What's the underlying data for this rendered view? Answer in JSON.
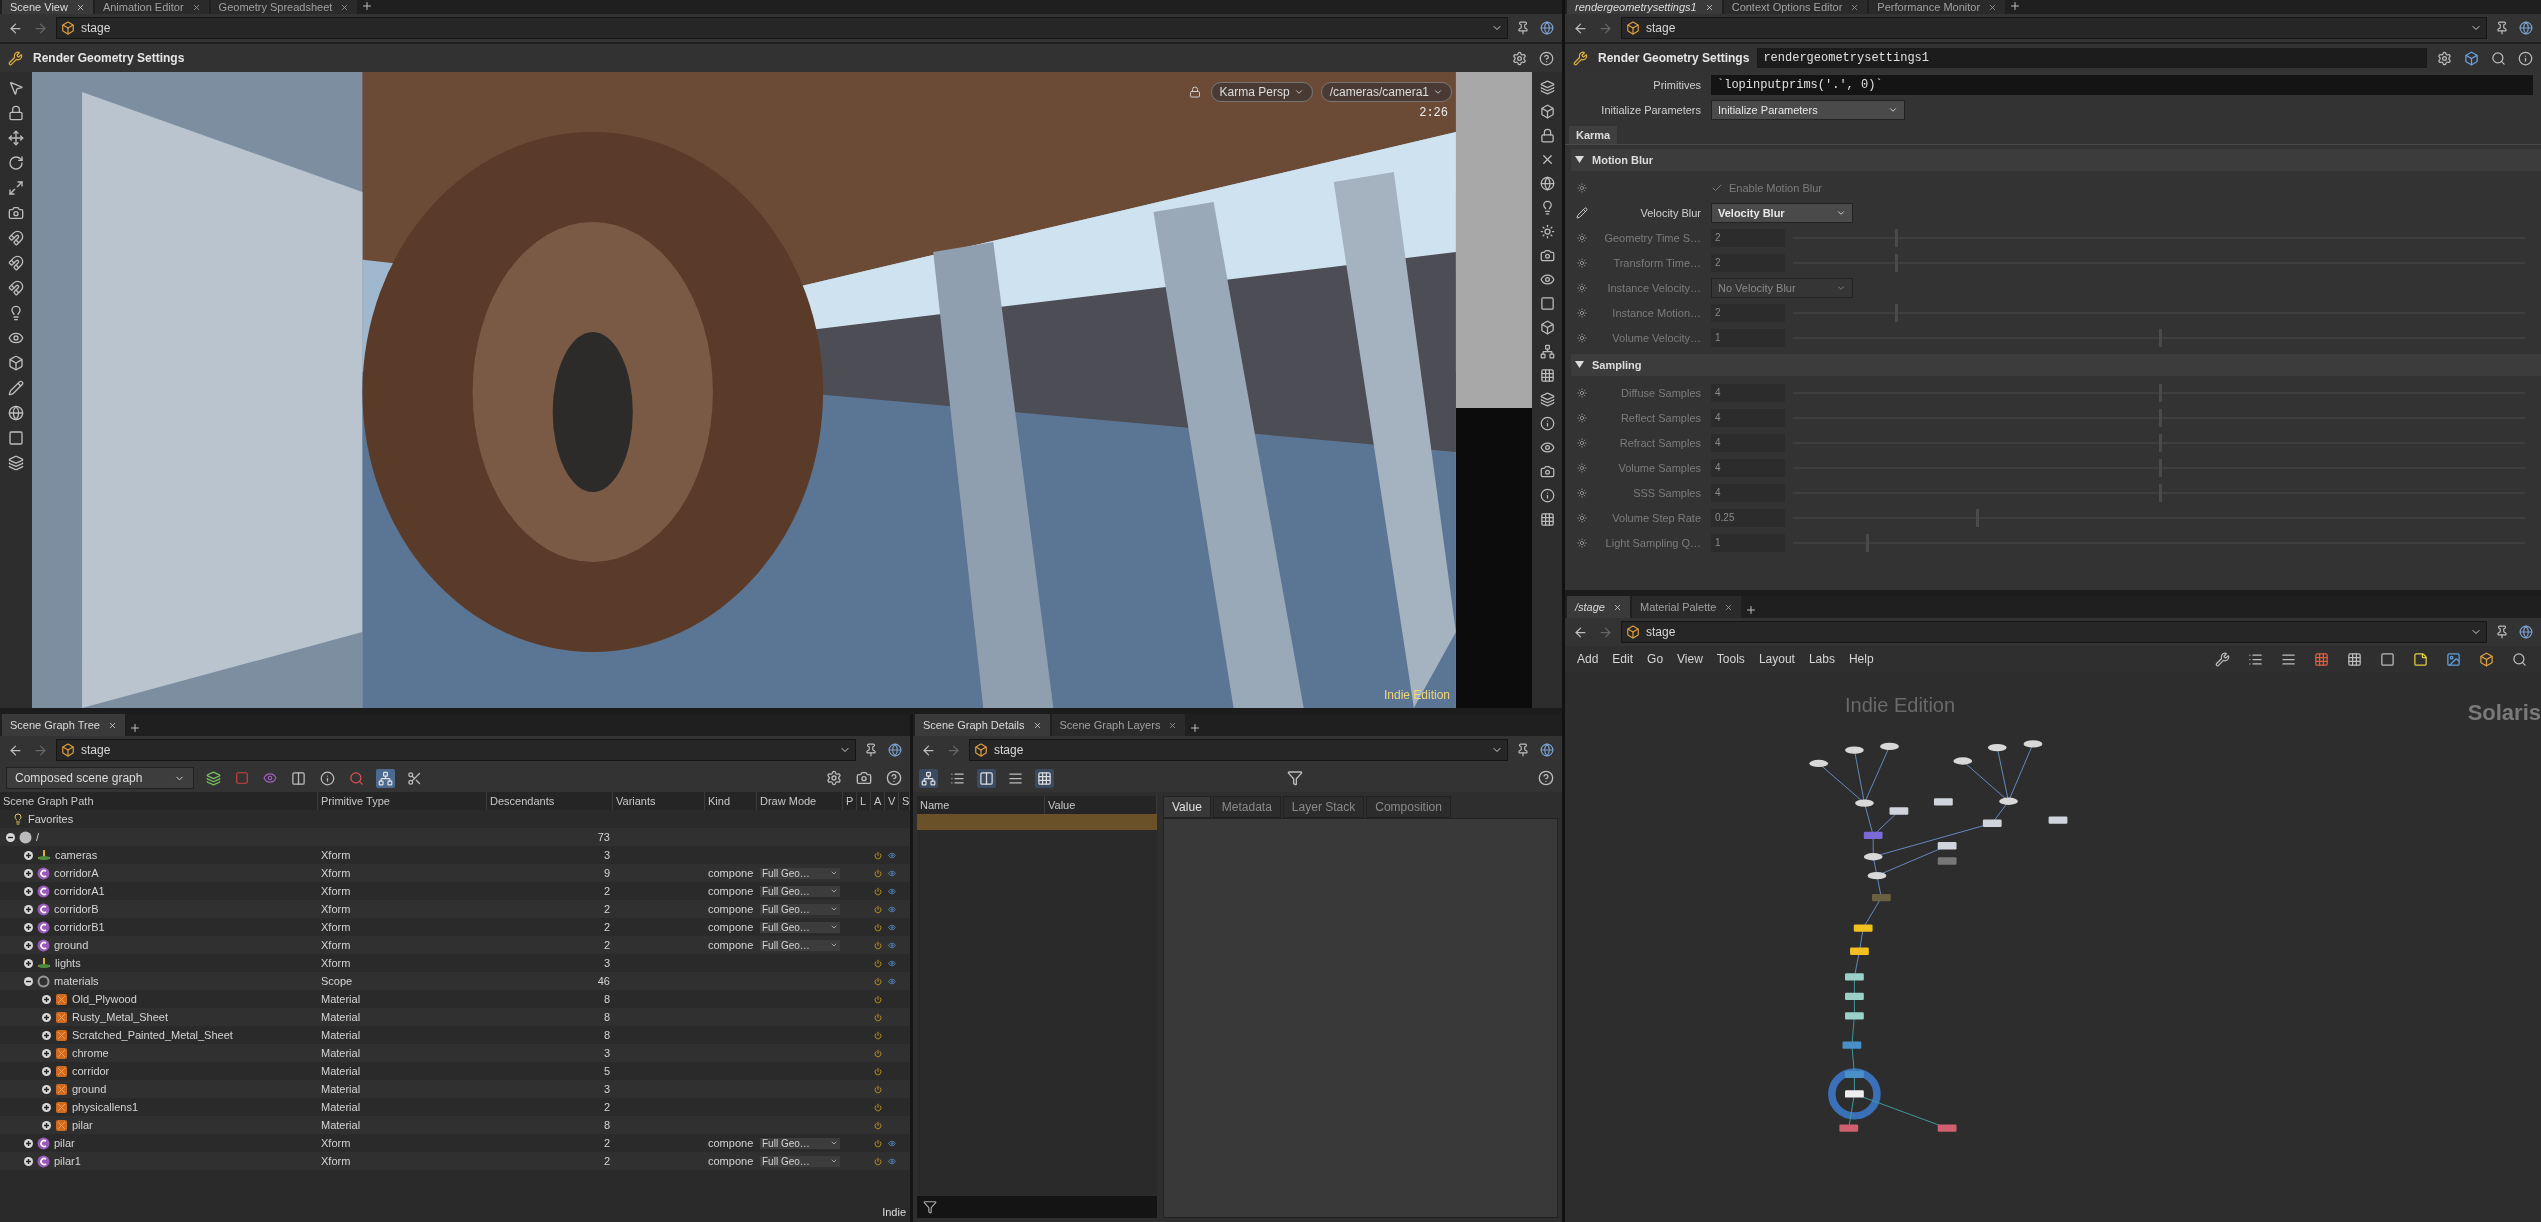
{
  "main_tabs": [
    {
      "label": "Scene View",
      "selected": true
    },
    {
      "label": "Animation Editor",
      "selected": false
    },
    {
      "label": "Geometry Spreadsheet",
      "selected": false
    }
  ],
  "viewport": {
    "path": "stage",
    "title": "Render Geometry Settings",
    "renderer": "Karma  Persp",
    "camera": "/cameras/camera1",
    "time": "2:26",
    "edition": "Indie Edition"
  },
  "tree_pane": {
    "tabs": [
      {
        "label": "Scene Graph Tree",
        "selected": true
      }
    ],
    "path": "stage",
    "mode": "Composed scene graph",
    "columns": [
      "Scene Graph Path",
      "Primitive Type",
      "Descendants",
      "Variants",
      "Kind",
      "Draw Mode",
      "P",
      "L",
      "A",
      "V",
      "S"
    ],
    "favorites": "Favorites",
    "edition": "Indie",
    "rows": [
      {
        "name": "/",
        "type": "",
        "descendants": "73",
        "kind": "root",
        "expanded": true,
        "active": false,
        "visible": false,
        "children": [
          {
            "name": "cameras",
            "type": "Xform",
            "descendants": "3",
            "kind": "null",
            "expanded": false,
            "active": true,
            "visible": true
          },
          {
            "name": "corridorA",
            "type": "Xform",
            "descendants": "9",
            "prim_kind": "compone",
            "draw_mode": "Full Geo…",
            "kind": "component",
            "expanded": false,
            "active": true,
            "visible": true
          },
          {
            "name": "corridorA1",
            "type": "Xform",
            "descendants": "2",
            "prim_kind": "compone",
            "draw_mode": "Full Geo…",
            "kind": "component",
            "expanded": false,
            "active": true,
            "visible": true
          },
          {
            "name": "corridorB",
            "type": "Xform",
            "descendants": "2",
            "prim_kind": "compone",
            "draw_mode": "Full Geo…",
            "kind": "component",
            "expanded": false,
            "active": true,
            "visible": true
          },
          {
            "name": "corridorB1",
            "type": "Xform",
            "descendants": "2",
            "prim_kind": "compone",
            "draw_mode": "Full Geo…",
            "kind": "component",
            "expanded": false,
            "active": true,
            "visible": true
          },
          {
            "name": "ground",
            "type": "Xform",
            "descendants": "2",
            "prim_kind": "compone",
            "draw_mode": "Full Geo…",
            "kind": "component",
            "expanded": false,
            "active": true,
            "visible": true
          },
          {
            "name": "lights",
            "type": "Xform",
            "descendants": "3",
            "kind": "null",
            "expanded": false,
            "active": true,
            "visible": true
          },
          {
            "name": "materials",
            "type": "Scope",
            "descendants": "46",
            "kind": "scope",
            "expanded": true,
            "active": true,
            "visible": true,
            "children": [
              {
                "name": "Old_Plywood",
                "type": "Material",
                "descendants": "8",
                "kind": "material",
                "expanded": false,
                "active": true,
                "visible": false
              },
              {
                "name": "Rusty_Metal_Sheet",
                "type": "Material",
                "descendants": "8",
                "kind": "material",
                "expanded": false,
                "active": true,
                "visible": false
              },
              {
                "name": "Scratched_Painted_Metal_Sheet",
                "type": "Material",
                "descendants": "8",
                "kind": "material",
                "expanded": false,
                "active": true,
                "visible": false
              },
              {
                "name": "chrome",
                "type": "Material",
                "descendants": "3",
                "kind": "material",
                "expanded": false,
                "active": true,
                "visible": false
              },
              {
                "name": "corridor",
                "type": "Material",
                "descendants": "5",
                "kind": "material",
                "expanded": false,
                "active": true,
                "visible": false
              },
              {
                "name": "ground",
                "type": "Material",
                "descendants": "3",
                "kind": "material",
                "expanded": false,
                "active": true,
                "visible": false
              },
              {
                "name": "physicallens1",
                "type": "Material",
                "descendants": "2",
                "kind": "material",
                "expanded": false,
                "active": true,
                "visible": false
              },
              {
                "name": "pilar",
                "type": "Material",
                "descendants": "8",
                "kind": "material",
                "expanded": false,
                "active": true,
                "visible": false
              }
            ]
          },
          {
            "name": "pilar",
            "type": "Xform",
            "descendants": "2",
            "prim_kind": "compone",
            "draw_mode": "Full Geo…",
            "kind": "component",
            "expanded": false,
            "active": true,
            "visible": true
          },
          {
            "name": "pilar1",
            "type": "Xform",
            "descendants": "2",
            "prim_kind": "compone",
            "draw_mode": "Full Geo…",
            "kind": "component",
            "expanded": false,
            "active": true,
            "visible": true
          }
        ]
      }
    ]
  },
  "details_pane": {
    "tabs": [
      {
        "label": "Scene Graph Details",
        "selected": true
      },
      {
        "label": "Scene Graph Layers",
        "selected": false
      }
    ],
    "path": "stage",
    "columns": [
      "Name",
      "Value"
    ],
    "rows": [
      {
        "selected": true
      }
    ],
    "value_tabs": [
      {
        "label": "Value",
        "selected": true
      },
      {
        "label": "Metadata",
        "selected": false
      },
      {
        "label": "Layer Stack",
        "selected": false
      },
      {
        "label": "Composition",
        "selected": false
      }
    ]
  },
  "params": {
    "tabs": [
      {
        "label": "rendergeometrysettings1",
        "selected": true
      },
      {
        "label": "Context Options Editor",
        "selected": false
      },
      {
        "label": "Performance Monitor",
        "selected": false
      }
    ],
    "path": "stage",
    "node_type": "Render Geometry Settings",
    "node_name": "rendergeometrysettings1",
    "primitives_label": "Primitives",
    "primitives_value": "`lopinputprims('.', 0)`",
    "init_label": "Initialize Parameters",
    "init_value": "Initialize Parameters",
    "folder_tabs": [
      {
        "label": "Karma",
        "selected": true
      }
    ],
    "sections": [
      {
        "title": "Motion Blur",
        "expanded": true,
        "rows": [
          {
            "kind": "checkbox",
            "label": "Enable Motion Blur",
            "checked": true,
            "disabled": true
          },
          {
            "kind": "menu",
            "label": "Velocity Blur",
            "value": "Velocity Blur",
            "disabled": false
          },
          {
            "kind": "slider",
            "label": "Geometry Time S…",
            "value": "2",
            "level": 0.14,
            "disabled": true
          },
          {
            "kind": "slider",
            "label": "Transform Time…",
            "value": "2",
            "level": 0.14,
            "disabled": true
          },
          {
            "kind": "menu",
            "label": "Instance Velocity…",
            "value": "No Velocity Blur",
            "disabled": true
          },
          {
            "kind": "slider",
            "label": "Instance Motion…",
            "value": "2",
            "level": 0.14,
            "disabled": true
          },
          {
            "kind": "slider",
            "label": "Volume Velocity…",
            "value": "1",
            "level": 0.5,
            "disabled": true
          }
        ]
      },
      {
        "title": "Sampling",
        "expanded": true,
        "rows": [
          {
            "kind": "slider",
            "label": "Diffuse Samples",
            "value": "4",
            "level": 0.5,
            "disabled": true
          },
          {
            "kind": "slider",
            "label": "Reflect Samples",
            "value": "4",
            "level": 0.5,
            "disabled": true
          },
          {
            "kind": "slider",
            "label": "Refract Samples",
            "value": "4",
            "level": 0.5,
            "disabled": true
          },
          {
            "kind": "slider",
            "label": "Volume Samples",
            "value": "4",
            "level": 0.5,
            "disabled": true
          },
          {
            "kind": "slider",
            "label": "SSS Samples",
            "value": "4",
            "level": 0.5,
            "disabled": true
          },
          {
            "kind": "slider",
            "label": "Volume Step Rate",
            "value": "0.25",
            "level": 0.25,
            "disabled": true
          },
          {
            "kind": "slider",
            "label": "Light Sampling Q…",
            "value": "1",
            "level": 0.1,
            "disabled": true
          }
        ]
      }
    ]
  },
  "network": {
    "tabs": [
      {
        "label": "/stage",
        "selected": true
      },
      {
        "label": "Material Palette",
        "selected": false
      }
    ],
    "path": "stage",
    "menu": [
      "Add",
      "Edit",
      "Go",
      "View",
      "Tools",
      "Layout",
      "Labs",
      "Help"
    ],
    "watermark": "Indie Edition",
    "context": "Solaris"
  }
}
